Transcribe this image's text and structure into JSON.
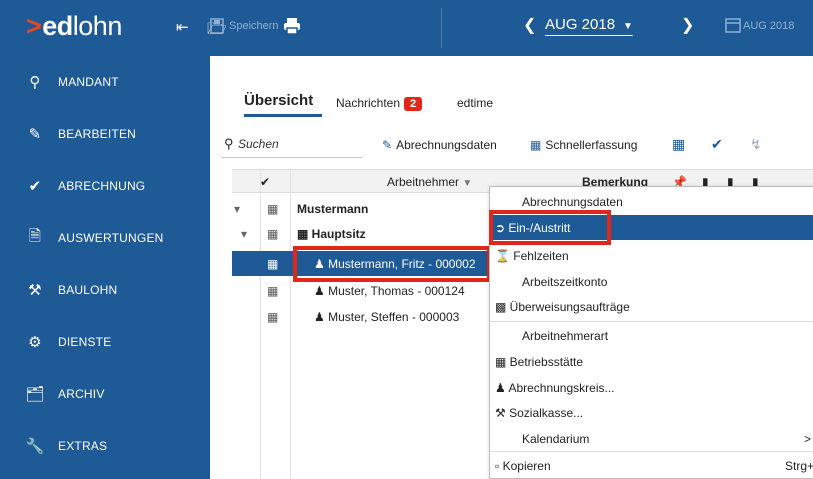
{
  "app": {
    "logo_prefix": ">",
    "logo_bold": "ed",
    "logo_light": "lohn"
  },
  "toolbar": {
    "save_label": "Speichern",
    "period": "AUG 2018",
    "period_next": "AUG 2018"
  },
  "sidebar": {
    "items": [
      {
        "label": "MANDANT",
        "icon": "map-pin-icon"
      },
      {
        "label": "BEARBEITEN",
        "icon": "pencil-icon"
      },
      {
        "label": "ABRECHNUNG",
        "icon": "checkmark-icon"
      },
      {
        "label": "AUSWERTUNGEN",
        "icon": "document-icon"
      },
      {
        "label": "BAULOHN",
        "icon": "worker-icon"
      },
      {
        "label": "DIENSTE",
        "icon": "gears-icon"
      },
      {
        "label": "ARCHIV",
        "icon": "archive-icon"
      },
      {
        "label": "EXTRAS",
        "icon": "wrench-icon"
      }
    ]
  },
  "tabs": {
    "overview": "Übersicht",
    "messages": "Nachrichten",
    "messages_count": "2",
    "edtime": "edtime"
  },
  "search": {
    "placeholder": "Suchen"
  },
  "actions": {
    "billing_data": "Abrechnungsdaten",
    "quick_entry": "Schnellerfassung"
  },
  "grid": {
    "col_employee": "Arbeitnehmer",
    "col_remark": "Bemerkung",
    "rows": [
      {
        "label": "Mustermann"
      },
      {
        "label": "Hauptsitz"
      },
      {
        "label": "Mustermann, Fritz - 000002"
      },
      {
        "label": "Muster, Thomas - 000124"
      },
      {
        "label": "Muster, Steffen - 000003"
      }
    ]
  },
  "context_menu": {
    "items": [
      {
        "label": "Abrechnungsdaten"
      },
      {
        "label": "Ein-/Austritt"
      },
      {
        "label": "Fehlzeiten"
      },
      {
        "label": "Arbeitszeitkonto"
      },
      {
        "label": "Überweisungsaufträge"
      },
      {
        "label": "Arbeitnehmerart"
      },
      {
        "label": "Betriebsstätte"
      },
      {
        "label": "Abrechnungskreis..."
      },
      {
        "label": "Sozialkasse..."
      },
      {
        "label": "Kalendarium",
        "submenu": ">"
      },
      {
        "label": "Kopieren",
        "shortcut": "Strg+C"
      }
    ]
  },
  "colors": {
    "primary": "#1e5a96",
    "accent": "#e8471c",
    "highlight": "#e1261c"
  }
}
